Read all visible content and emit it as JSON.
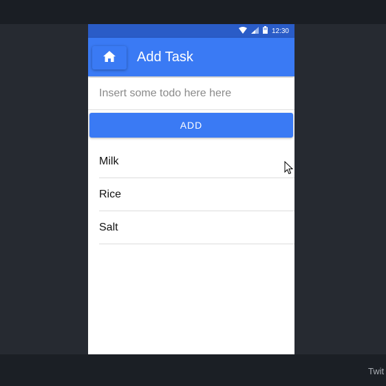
{
  "app": {
    "title": "Add Task",
    "home_icon": "home-icon"
  },
  "status_bar": {
    "time": "12:30",
    "icons": [
      "wifi-icon",
      "signal-icon",
      "battery-icon"
    ]
  },
  "form": {
    "placeholder": "Insert some todo here here",
    "value": "",
    "add_label": "ADD"
  },
  "todos": [
    {
      "label": "Milk"
    },
    {
      "label": "Rice"
    },
    {
      "label": "Salt"
    }
  ],
  "taskbar": {
    "label": "Twit"
  },
  "colors": {
    "primary": "#3a7af4",
    "status_bar": "#2a5cc7",
    "desktop": "#262a31"
  }
}
